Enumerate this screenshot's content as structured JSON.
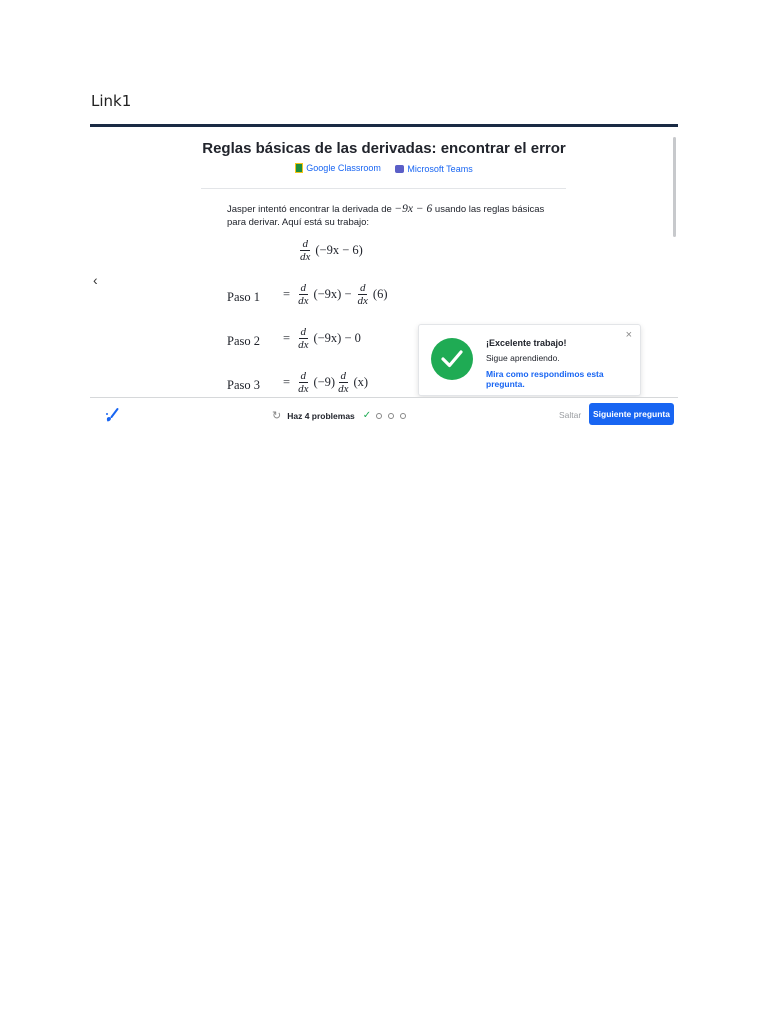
{
  "doc_label": "Link1",
  "exercise": {
    "title": "Reglas básicas de las derivadas: encontrar el error",
    "share": {
      "google_classroom": "Google Classroom",
      "microsoft_teams": "Microsoft Teams"
    },
    "prompt_before": "Jasper intentó encontrar la derivada de ",
    "prompt_math": "−9x − 6",
    "prompt_after": " usando las reglas básicas para derivar. Aquí está su trabajo:",
    "initial_expr": "(−9x − 6)",
    "steps": [
      {
        "label": "Paso 1",
        "expr_a": "(−9x) −",
        "expr_b": "(6)"
      },
      {
        "label": "Paso 2",
        "expr_a": "(−9x) − 0"
      },
      {
        "label": "Paso 3",
        "expr_a": "(−9)",
        "expr_b": "(x)"
      }
    ],
    "frac_num": "d",
    "frac_den": "dx",
    "equals": "="
  },
  "toast": {
    "title": "¡Excelente trabajo!",
    "subtitle": "Sigue aprendiendo.",
    "link": "Mira como respondimos esta pregunta.",
    "close": "×",
    "accent": "#1fab54"
  },
  "footer": {
    "progress_label": "Haz 4 problemas",
    "progress_done": 1,
    "progress_total": 4,
    "skip_label": "Saltar",
    "next_label": "Siguiente pregunta",
    "accent": "#1865f2"
  }
}
